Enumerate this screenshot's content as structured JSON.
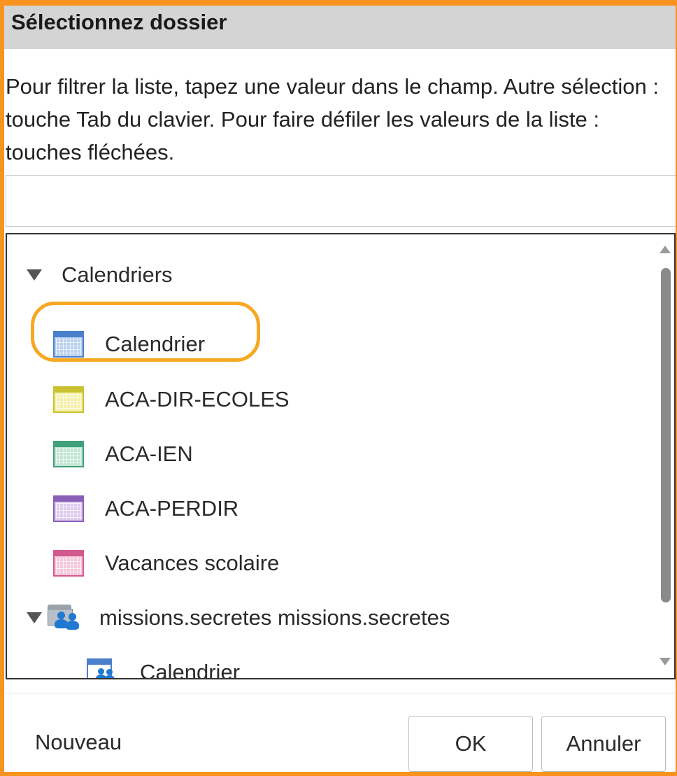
{
  "dialog": {
    "title": "Sélectionnez dossier",
    "instructions": "Pour filtrer la liste, tapez une valeur dans le champ. Autre sélection : touche Tab du clavier. Pour faire défiler les valeurs de la liste : touches fléchées."
  },
  "filter": {
    "value": "",
    "placeholder": ""
  },
  "tree": {
    "groups": [
      {
        "label": "Calendriers",
        "expanded": true,
        "items": [
          {
            "label": "Calendrier",
            "color": "#4a7fcb",
            "fill": "#b8d0f0",
            "highlighted": true
          },
          {
            "label": "ACA-DIR-ECOLES",
            "color": "#c9c230",
            "fill": "#f4f0a8"
          },
          {
            "label": "ACA-IEN",
            "color": "#3fa07c",
            "fill": "#bfe5d3"
          },
          {
            "label": "ACA-PERDIR",
            "color": "#8a5fb8",
            "fill": "#dccbef"
          },
          {
            "label": "Vacances scolaire",
            "color": "#d25a8e",
            "fill": "#f5c6da"
          }
        ]
      },
      {
        "label": "missions.secretes missions.secretes",
        "expanded": true,
        "icon": "shared-folder-icon",
        "items": [
          {
            "label": "Calendrier",
            "icon": "shared-calendar-icon",
            "color": "#4a7fcb"
          }
        ]
      }
    ]
  },
  "footer": {
    "new_label": "Nouveau",
    "ok_label": "OK",
    "cancel_label": "Annuler"
  },
  "colors": {
    "frame_accent": "#f7931e",
    "highlight_ring": "#f7a823",
    "titlebar_bg": "#d4d4d4"
  }
}
